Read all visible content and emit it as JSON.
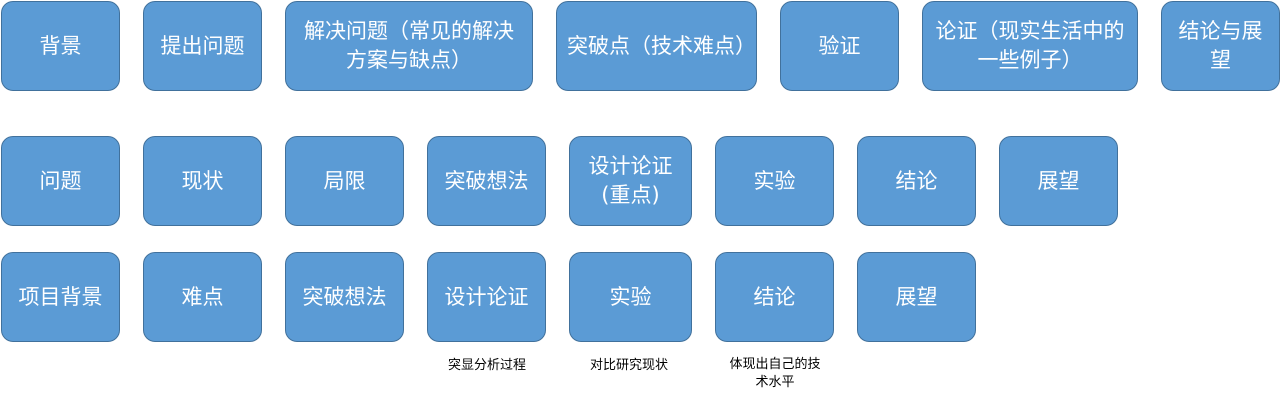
{
  "row1": [
    "背景",
    "提出问题",
    "解决问题（常见的解决方案与缺点）",
    "突破点（技术难点）",
    "验证",
    "论证（现实生活中的一些例子）",
    "结论与展望"
  ],
  "row2": [
    "问题",
    "现状",
    "局限",
    "突破想法",
    "设计论证(重点)",
    "实验",
    "结论",
    "展望"
  ],
  "row3": [
    "项目背景",
    "难点",
    "突破想法",
    "设计论证",
    "实验",
    "结论",
    "展望"
  ],
  "notes": [
    "突显分析过程",
    "对比研究现状",
    "体现出自己的技术水平"
  ],
  "colors": {
    "box_fill": "#5b9bd5",
    "box_border": "#41719c",
    "box_text": "#ffffff",
    "note_text": "#000000"
  }
}
